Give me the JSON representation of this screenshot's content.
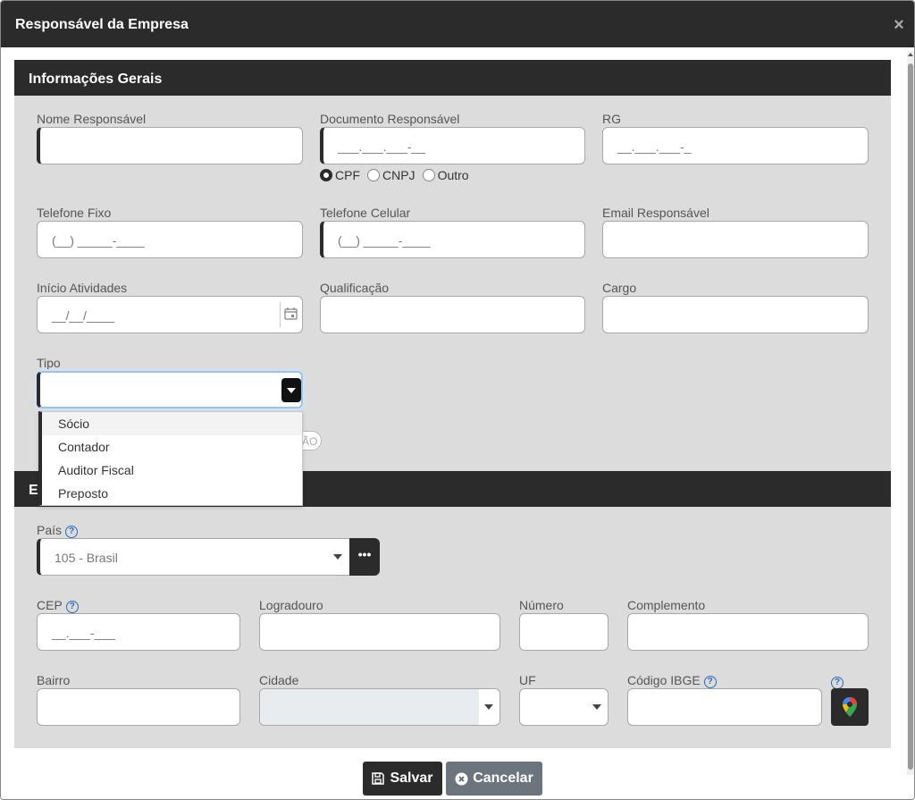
{
  "modal": {
    "title": "Responsável da Empresa",
    "close": "×"
  },
  "general": {
    "title": "Informações Gerais",
    "nome_label": "Nome Responsável",
    "documento_label": "Documento Responsável",
    "documento_mask": "___.___.___-__",
    "rg_label": "RG",
    "rg_mask": "__.___.___-_",
    "doc_types": [
      "CPF",
      "CNPJ",
      "Outro"
    ],
    "doc_type_selected": "CPF",
    "telefone_fixo_label": "Telefone Fixo",
    "telefone_fixo_mask": "(__) _____-____",
    "telefone_celular_label": "Telefone Celular",
    "telefone_celular_mask": "(__) _____-____",
    "email_label": "Email Responsável",
    "inicio_label": "Início Atividades",
    "inicio_mask": "__/__/____",
    "qualificacao_label": "Qualificação",
    "cargo_label": "Cargo",
    "tipo_label": "Tipo",
    "tipo_options": [
      "Sócio",
      "Contador",
      "Auditor Fiscal",
      "Preposto"
    ],
    "hidden_peek": "ÃO"
  },
  "address": {
    "title_peek": "E",
    "pais_label": "País",
    "pais_value": "105 - Brasil",
    "cep_label": "CEP",
    "cep_mask": "__.___-___",
    "logradouro_label": "Logradouro",
    "numero_label": "Número",
    "complemento_label": "Complemento",
    "bairro_label": "Bairro",
    "cidade_label": "Cidade",
    "uf_label": "UF",
    "ibge_label": "Código IBGE",
    "help": "?"
  },
  "footer": {
    "save_label": "Salvar",
    "cancel_label": "Cancelar"
  },
  "colors": {
    "dark": "#2b2b2b",
    "panel": "#dcdcdc",
    "cancel": "#6c757d",
    "help": "#2a6ab5"
  }
}
